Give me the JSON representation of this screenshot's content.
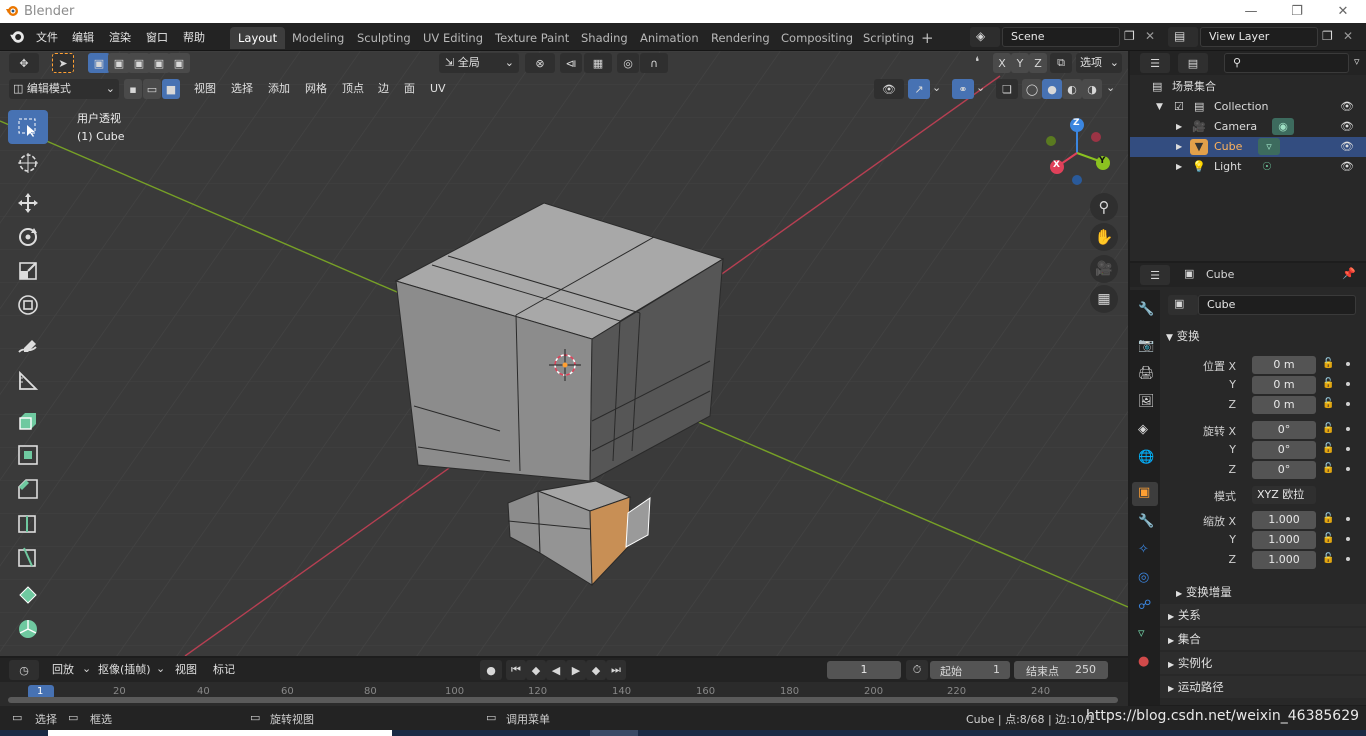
{
  "window": {
    "title": "Blender"
  },
  "menu": [
    "文件",
    "编辑",
    "渲染",
    "窗口",
    "帮助"
  ],
  "workspaces": [
    "Layout",
    "Modeling",
    "Sculpting",
    "UV Editing",
    "Texture Paint",
    "Shading",
    "Animation",
    "Rendering",
    "Compositing",
    "Scripting"
  ],
  "active_workspace": "Layout",
  "scene": {
    "name": "Scene",
    "view_layer": "View Layer"
  },
  "viewport_header": {
    "transform_orientation": "全局",
    "options_label": "选项",
    "axes": [
      "X",
      "Y",
      "Z"
    ],
    "mode": "编辑模式",
    "menus": [
      "视图",
      "选择",
      "添加",
      "网格",
      "顶点",
      "边",
      "面",
      "UV"
    ]
  },
  "viewport": {
    "view_name": "用户透视",
    "object_label": "(1) Cube",
    "gizmo_axes": [
      "Z",
      "Y",
      "X"
    ]
  },
  "outliner": {
    "root": "场景集合",
    "items": [
      {
        "name": "Collection",
        "level": 1
      },
      {
        "name": "Camera",
        "level": 2
      },
      {
        "name": "Cube",
        "level": 2,
        "selected": true
      },
      {
        "name": "Light",
        "level": 2
      }
    ]
  },
  "properties": {
    "object_name": "Cube",
    "object_field": "Cube",
    "transform_section": "变换",
    "location_label": "位置 X",
    "rotation_label": "旋转 X",
    "scale_label": "缩放 X",
    "axis_y": "Y",
    "axis_z": "Z",
    "location": [
      "0 m",
      "0 m",
      "0 m"
    ],
    "rotation": [
      "0°",
      "0°",
      "0°"
    ],
    "mode_label": "模式",
    "rotation_mode": "XYZ 欧拉",
    "scale": [
      "1.000",
      "1.000",
      "1.000"
    ],
    "delta_transform": "变换增量",
    "sections": [
      "关系",
      "集合",
      "实例化",
      "运动路径"
    ]
  },
  "timeline": {
    "menus": [
      "回放",
      "抠像(插帧)",
      "视图",
      "标记"
    ],
    "current_frame": "1",
    "start_label": "起始",
    "start": "1",
    "end_label": "结束点",
    "end": "250",
    "ruler_ticks": [
      "1",
      "20",
      "40",
      "60",
      "80",
      "100",
      "120",
      "140",
      "160",
      "180",
      "200",
      "220",
      "240"
    ]
  },
  "statusbar": {
    "select": "选择",
    "box_select": "框选",
    "rotate_view": "旋转视图",
    "call_menu": "调用菜单",
    "stats": "Cube | 点:8/68 | 边:10/1",
    "watermark": "https://blog.csdn.net/weixin_46385629"
  },
  "colors": {
    "accent": "#4772b3",
    "x_axis": "#e0415a",
    "y_axis": "#8bc220",
    "z_axis": "#3b86e0",
    "selection": "#ffa033"
  }
}
